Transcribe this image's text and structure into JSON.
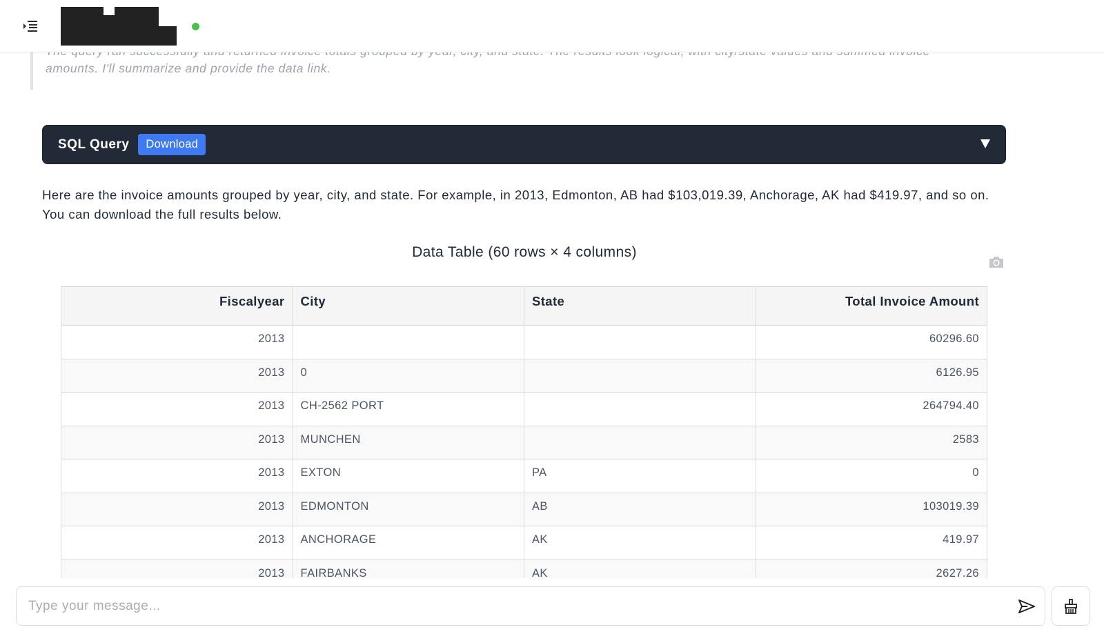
{
  "header": {
    "menu_icon": "menu-indent-icon",
    "status_color": "#4cbf4c"
  },
  "thinking": {
    "text": "The query ran successfully and returned invoice totals grouped by year, city, and state. The results look logical, with city/state values and summed invoice amounts. I'll summarize and provide the data link."
  },
  "sql_panel": {
    "title": "SQL Query",
    "download_label": "Download",
    "toggle_icon": "caret-down-icon"
  },
  "summary": {
    "text": "Here are the invoice amounts grouped by year, city, and state. For example, in 2013, Edmonton, AB had $103,019.39, Anchorage, AK had $419.97, and so on. You can download the full results below."
  },
  "table": {
    "title": "Data Table (60 rows × 4 columns)",
    "columns": [
      "Fiscalyear",
      "City",
      "State",
      "Total Invoice Amount"
    ],
    "rows": [
      [
        "2013",
        "",
        "",
        "60296.60"
      ],
      [
        "2013",
        "0",
        "",
        "6126.95"
      ],
      [
        "2013",
        "CH-2562 PORT",
        "",
        "264794.40"
      ],
      [
        "2013",
        "MUNCHEN",
        "",
        "2583"
      ],
      [
        "2013",
        "EXTON",
        " PA",
        "0"
      ],
      [
        "2013",
        "EDMONTON",
        "AB",
        "103019.39"
      ],
      [
        "2013",
        "ANCHORAGE",
        "AK",
        "419.97"
      ],
      [
        "2013",
        "FAIRBANKS",
        "AK",
        "2627.26"
      ]
    ]
  },
  "input": {
    "placeholder": "Type your message...",
    "value": ""
  },
  "colors": {
    "accent": "#3f7af0",
    "sql_bar": "#222a38"
  }
}
